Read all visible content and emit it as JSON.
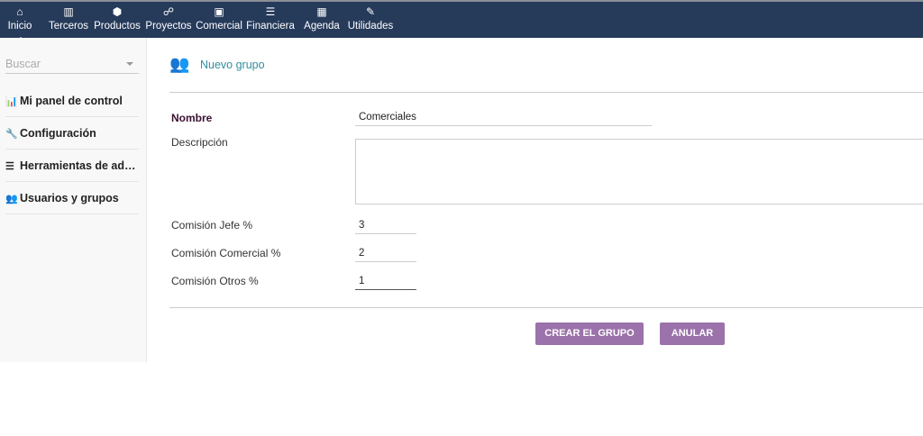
{
  "topnav": [
    {
      "label": "Inicio",
      "icon": "home-icon",
      "glyph": "⌂"
    },
    {
      "label": "Terceros",
      "icon": "building-icon",
      "glyph": "▥"
    },
    {
      "label": "Productos",
      "icon": "cube-icon",
      "glyph": "⬢"
    },
    {
      "label": "Proyectos",
      "icon": "sitemap-icon",
      "glyph": "☍"
    },
    {
      "label": "Comercial",
      "icon": "suitcase-icon",
      "glyph": "▣"
    },
    {
      "label": "Financiera",
      "icon": "coins-icon",
      "glyph": "☰"
    },
    {
      "label": "Agenda",
      "icon": "calendar-icon",
      "glyph": "▦"
    },
    {
      "label": "Utilidades",
      "icon": "wrench-icon",
      "glyph": "✎"
    }
  ],
  "sidebar": {
    "search_placeholder": "Buscar",
    "items": [
      {
        "label": "Mi panel de control",
        "glyph": "📊"
      },
      {
        "label": "Configuración",
        "glyph": "🔧"
      },
      {
        "label": "Herramientas de ad…",
        "glyph": "☰"
      },
      {
        "label": "Usuarios y grupos",
        "glyph": "👥"
      }
    ]
  },
  "page": {
    "title": "Nuevo grupo"
  },
  "form": {
    "nombre_label": "Nombre",
    "nombre_value": "Comerciales",
    "descripcion_label": "Descripción",
    "descripcion_value": "",
    "jefe_label": "Comisión Jefe %",
    "jefe_value": "3",
    "comercial_label": "Comisión Comercial %",
    "comercial_value": "2",
    "otros_label": "Comisión Otros %",
    "otros_value": "1"
  },
  "buttons": {
    "create": "CREAR EL GRUPO",
    "cancel": "ANULAR"
  },
  "colors": {
    "topbar": "#263a5a",
    "button": "#9b72aa",
    "title": "#2f8f9d"
  }
}
